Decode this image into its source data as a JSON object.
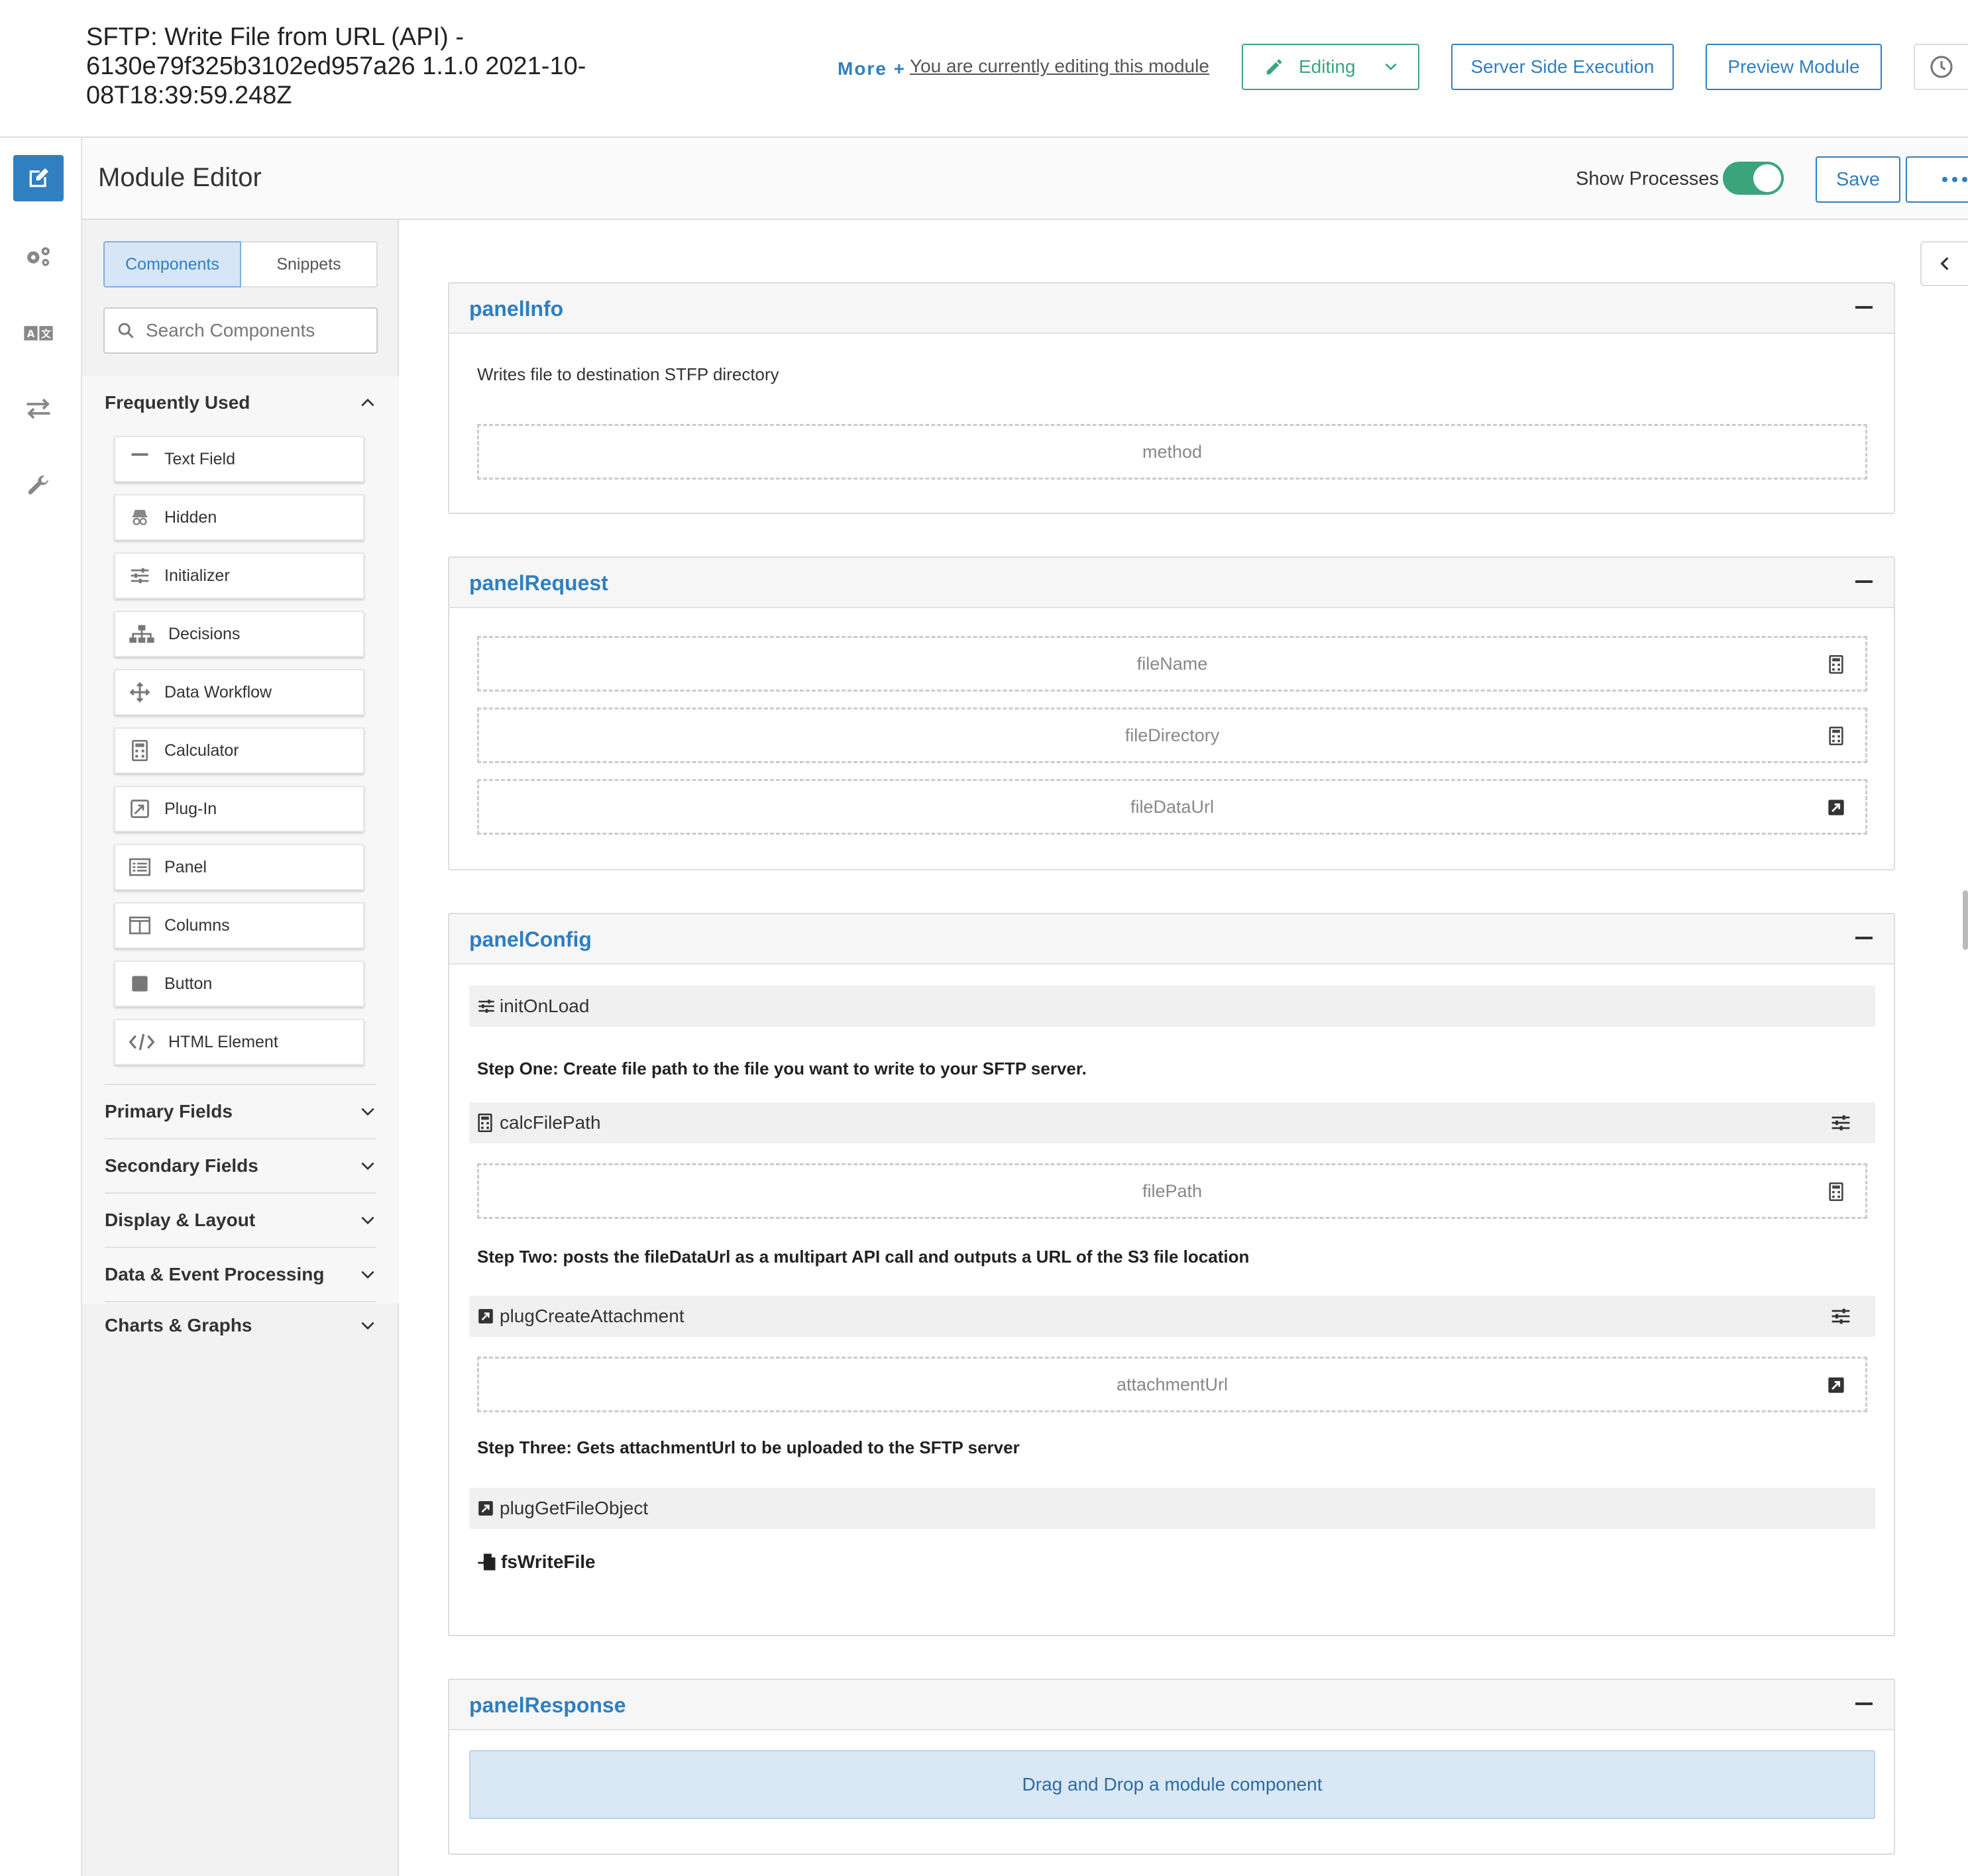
{
  "header": {
    "module_title": "SFTP: Write File from URL (API) - 6130e79f325b3102ed957a26 1.1.0 2021-10-08T18:39:59.248Z",
    "more_label": "More +",
    "editing_note": "You are currently editing this module",
    "editing_button": "Editing",
    "server_side_button": "Server Side Execution",
    "preview_button": "Preview Module",
    "history_icon": "clock-icon"
  },
  "rail": {
    "icons": [
      "edit-icon",
      "gears-icon",
      "translate-icon",
      "swap-arrows-icon",
      "wrench-icon"
    ]
  },
  "editor": {
    "title": "Module Editor",
    "show_processes_label": "Show Processes",
    "show_processes_on": true,
    "save_label": "Save"
  },
  "sidebar": {
    "tabs": [
      "Components",
      "Snippets"
    ],
    "active_tab": "Components",
    "search_placeholder": "Search Components",
    "frequently_used_label": "Frequently Used",
    "frequently_used": [
      {
        "label": "Text Field",
        "icon": "text-field-icon"
      },
      {
        "label": "Hidden",
        "icon": "hidden-icon"
      },
      {
        "label": "Initializer",
        "icon": "sliders-icon"
      },
      {
        "label": "Decisions",
        "icon": "sitemap-icon"
      },
      {
        "label": "Data Workflow",
        "icon": "move-arrows-icon"
      },
      {
        "label": "Calculator",
        "icon": "calculator-icon"
      },
      {
        "label": "Plug-In",
        "icon": "plugin-icon"
      },
      {
        "label": "Panel",
        "icon": "list-icon"
      },
      {
        "label": "Columns",
        "icon": "columns-icon"
      },
      {
        "label": "Button",
        "icon": "stop-square-icon"
      },
      {
        "label": "HTML Element",
        "icon": "code-icon"
      }
    ],
    "categories": [
      "Primary Fields",
      "Secondary Fields",
      "Display & Layout",
      "Data & Event Processing",
      "Charts & Graphs"
    ]
  },
  "panels": {
    "info": {
      "title": "panelInfo",
      "description": "Writes file to destination STFP directory",
      "fields": [
        "method"
      ]
    },
    "request": {
      "title": "panelRequest",
      "fields": [
        "fileName",
        "fileDirectory",
        "fileDataUrl"
      ]
    },
    "config": {
      "title": "panelConfig",
      "init_process": "initOnLoad",
      "step_one": "Step One: Create file path to the file you want to write to your SFTP server.",
      "calc_process": "calcFilePath",
      "file_path_field": "filePath",
      "step_two": "Step Two: posts the fileDataUrl as a multipart API call and outputs a URL of the S3 file location",
      "plug_create": "plugCreateAttachment",
      "attachment_field": "attachmentUrl",
      "step_three": "Step Three: Gets attachmentUrl to be uploaded to the SFTP server",
      "plug_get": "plugGetFileObject",
      "fs_write": "fsWriteFile"
    },
    "response": {
      "title": "panelResponse",
      "drop_zone": "Drag and Drop a module component"
    }
  }
}
